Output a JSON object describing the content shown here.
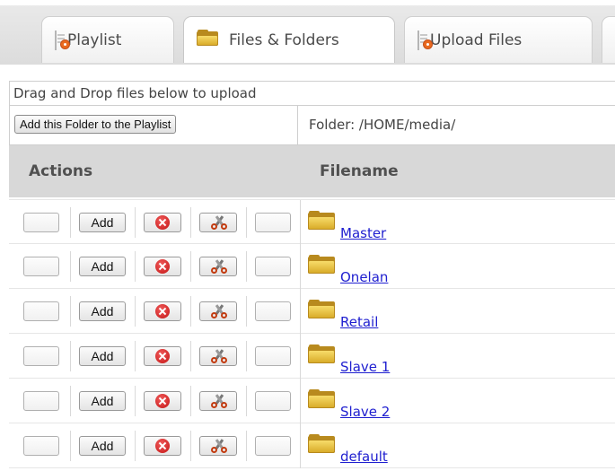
{
  "tabs": [
    {
      "label": "Playlist",
      "icon": "playlist-page-icon"
    },
    {
      "label": "Files & Folders",
      "icon": "folder-icon",
      "active": true
    },
    {
      "label": "Upload Files",
      "icon": "upload-page-icon"
    }
  ],
  "drop_hint": "Drag and Drop files below to upload",
  "add_folder_button": "Add this Folder to the Playlist",
  "folder_path": "Folder: /HOME/media/",
  "columns": {
    "actions": "Actions",
    "filename": "Filename"
  },
  "row_actions": {
    "add_label": "Add",
    "delete_icon": "delete-icon",
    "cut_icon": "scissors-icon"
  },
  "files": [
    {
      "name": "Master"
    },
    {
      "name": "Onelan"
    },
    {
      "name": "Retail"
    },
    {
      "name": "Slave 1"
    },
    {
      "name": "Slave 2"
    },
    {
      "name": "default"
    }
  ]
}
